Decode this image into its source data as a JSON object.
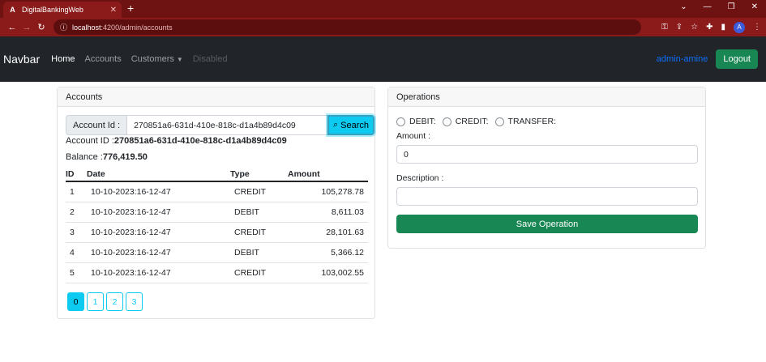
{
  "browser": {
    "tab_title": "DigitalBankingWeb",
    "tab_close": "✕",
    "new_tab": "+",
    "url_host": "localhost",
    "url_path": ":4200/admin/accounts",
    "win_controls": [
      "⌄",
      "—",
      "❐",
      "✕"
    ],
    "profile_initial": "A"
  },
  "navbar": {
    "brand": "Navbar",
    "links": [
      {
        "label": "Home",
        "state": "active"
      },
      {
        "label": "Accounts",
        "state": "normal"
      },
      {
        "label": "Customers",
        "state": "normal"
      },
      {
        "label": "Disabled",
        "state": "disabled"
      }
    ],
    "user": "admin-amine",
    "logout": "Logout"
  },
  "accounts": {
    "header": "Accounts",
    "search_label": "Account Id :",
    "search_value": "270851a6-631d-410e-818c-d1a4b89d4c09",
    "search_button": "Search",
    "account_id_label": "Account ID :",
    "account_id_value": "270851a6-631d-410e-818c-d1a4b89d4c09",
    "balance_label": "Balance :",
    "balance_value": "776,419.50",
    "columns": [
      "ID",
      "Date",
      "Type",
      "Amount"
    ],
    "rows": [
      {
        "id": "1",
        "date": "10-10-2023:16-12-47",
        "type": "CREDIT",
        "amount": "105,278.78"
      },
      {
        "id": "2",
        "date": "10-10-2023:16-12-47",
        "type": "DEBIT",
        "amount": "8,611.03"
      },
      {
        "id": "3",
        "date": "10-10-2023:16-12-47",
        "type": "CREDIT",
        "amount": "28,101.63"
      },
      {
        "id": "4",
        "date": "10-10-2023:16-12-47",
        "type": "DEBIT",
        "amount": "5,366.12"
      },
      {
        "id": "5",
        "date": "10-10-2023:16-12-47",
        "type": "CREDIT",
        "amount": "103,002.55"
      }
    ],
    "pages": [
      "0",
      "1",
      "2",
      "3"
    ],
    "active_page": "0"
  },
  "operations": {
    "header": "Operations",
    "types": [
      "DEBIT:",
      "CREDIT:",
      "TRANSFER:"
    ],
    "amount_label": "Amount :",
    "amount_value": "0",
    "description_label": "Description :",
    "description_value": "",
    "save_button": "Save Operation"
  },
  "colors": {
    "browser_frame": "#8b1a1a",
    "navbar_bg": "#212529",
    "success": "#198754",
    "info": "#0dcaf0",
    "primary": "#0d6efd"
  }
}
